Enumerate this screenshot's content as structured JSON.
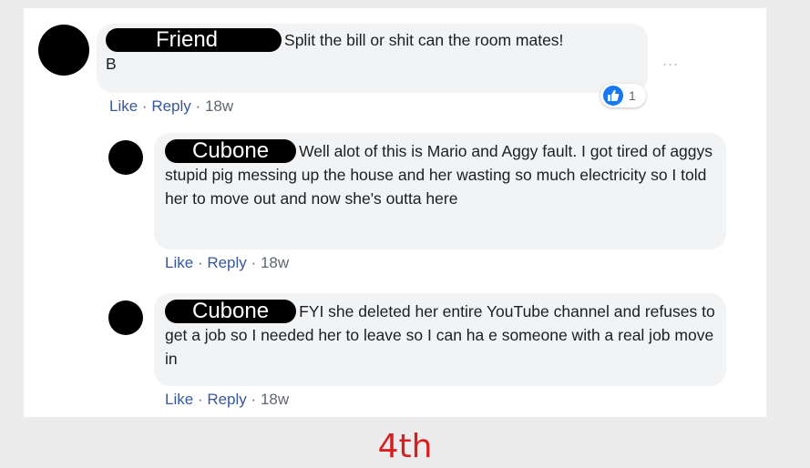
{
  "comments": [
    {
      "author": "Friend",
      "text": "Split the bill or shit can the room mates!",
      "text_line2": "B",
      "actions": {
        "like": "Like",
        "reply": "Reply",
        "time": "18w"
      },
      "reaction_count": "1"
    },
    {
      "author": "Cubone",
      "text": "Well alot of this is Mario and Aggy fault. I got tired of aggys stupid pig messing up the house and her wasting so much electricity so I told her to move out and now she's outta here",
      "actions": {
        "like": "Like",
        "reply": "Reply",
        "time": "18w"
      }
    },
    {
      "author": "Cubone",
      "text": "FYI she deleted her entire YouTube channel and refuses to get a job so I needed her to leave so I can ha e someone with a real job move in",
      "actions": {
        "like": "Like",
        "reply": "Reply",
        "time": "18w"
      }
    }
  ],
  "more_label": "...",
  "separator": "·",
  "caption": "4th",
  "colors": {
    "link": "#385898",
    "caption": "#d81f1f",
    "like_blue": "#1877f2"
  },
  "icons": {
    "like": "thumbs-up-icon",
    "more": "more-options-icon"
  }
}
